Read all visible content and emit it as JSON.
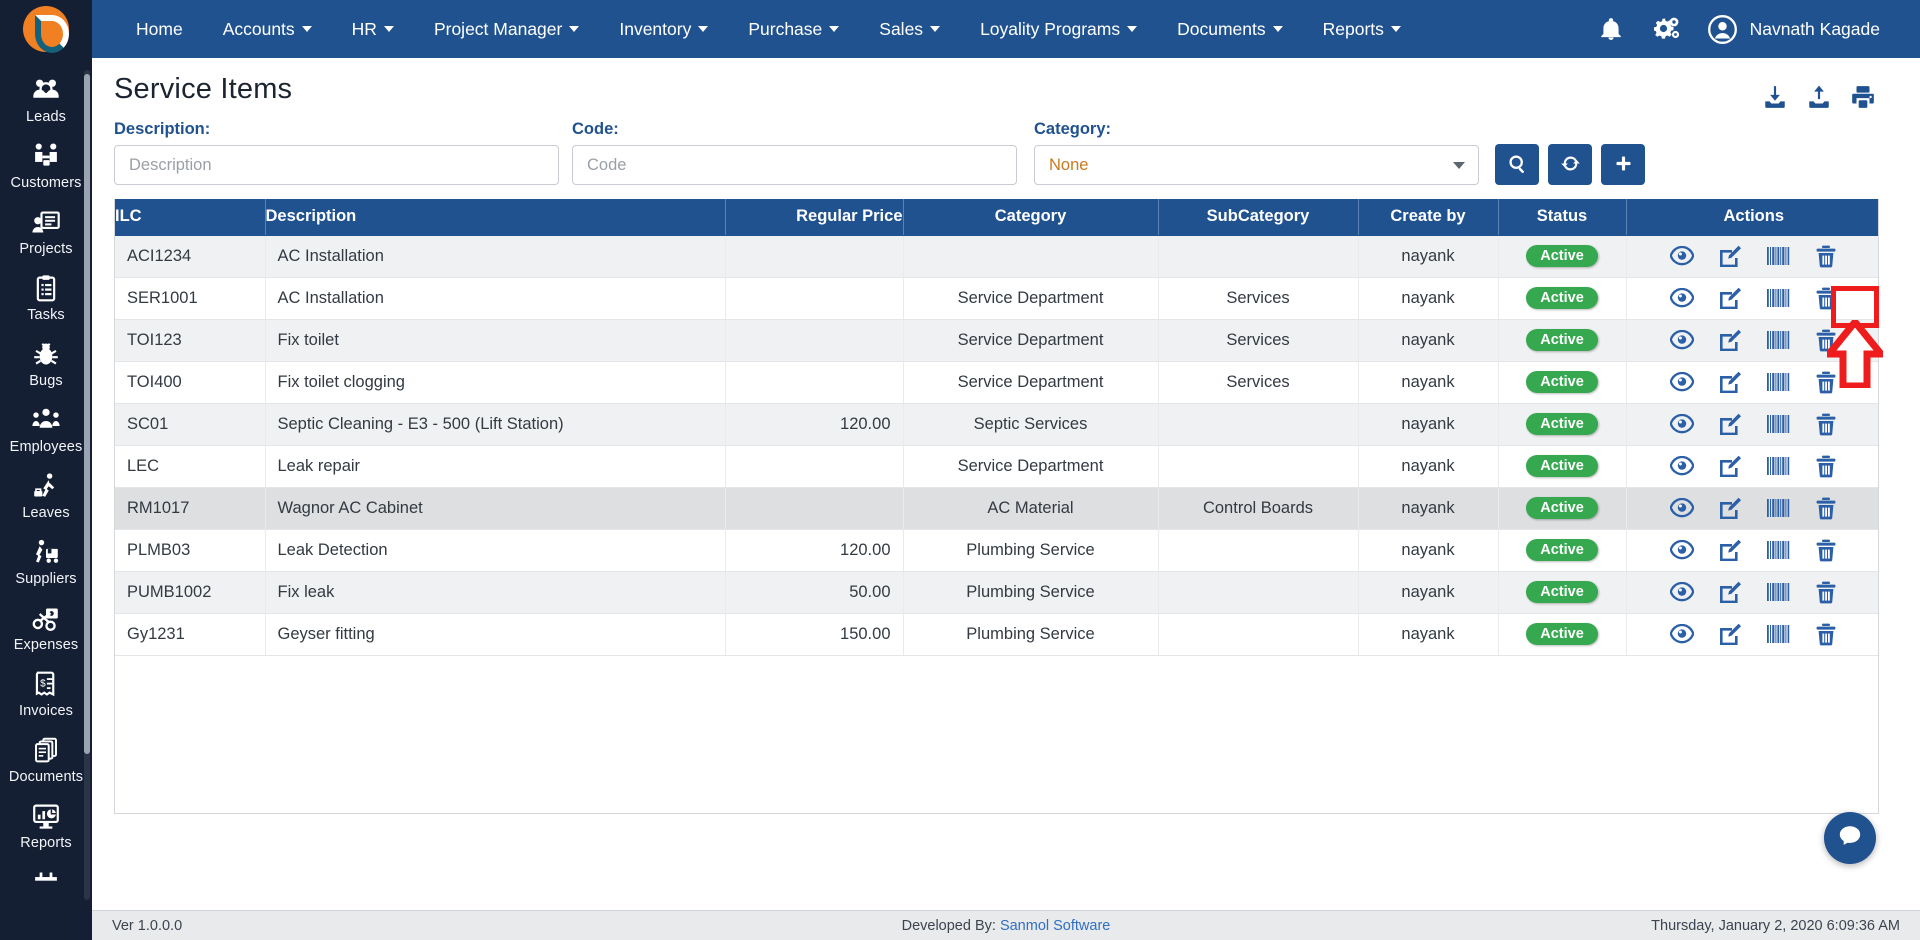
{
  "brand": {
    "logo_alt": "e-logo"
  },
  "topnav": {
    "items": [
      {
        "label": "Home",
        "caret": false
      },
      {
        "label": "Accounts",
        "caret": true
      },
      {
        "label": "HR",
        "caret": true
      },
      {
        "label": "Project Manager",
        "caret": true
      },
      {
        "label": "Inventory",
        "caret": true
      },
      {
        "label": "Purchase",
        "caret": true
      },
      {
        "label": "Sales",
        "caret": true
      },
      {
        "label": "Loyality Programs",
        "caret": true
      },
      {
        "label": "Documents",
        "caret": true
      },
      {
        "label": "Reports",
        "caret": true
      }
    ],
    "user_name": "Navnath Kagade"
  },
  "sidebar": {
    "items": [
      {
        "label": "Leads",
        "icon": "leads-icon"
      },
      {
        "label": "Customers",
        "icon": "customers-icon"
      },
      {
        "label": "Projects",
        "icon": "projects-icon"
      },
      {
        "label": "Tasks",
        "icon": "tasks-icon"
      },
      {
        "label": "Bugs",
        "icon": "bugs-icon"
      },
      {
        "label": "Employees",
        "icon": "employees-icon"
      },
      {
        "label": "Leaves",
        "icon": "leaves-icon"
      },
      {
        "label": "Suppliers",
        "icon": "suppliers-icon"
      },
      {
        "label": "Expenses",
        "icon": "expenses-icon"
      },
      {
        "label": "Invoices",
        "icon": "invoices-icon"
      },
      {
        "label": "Documents",
        "icon": "documents-icon"
      },
      {
        "label": "Reports",
        "icon": "reports-icon"
      }
    ]
  },
  "page": {
    "title": "Service Items",
    "tools": [
      {
        "name": "download-icon"
      },
      {
        "name": "upload-icon"
      },
      {
        "name": "print-icon"
      }
    ]
  },
  "filters": {
    "description_label": "Description:",
    "description_placeholder": "Description",
    "description_value": "",
    "code_label": "Code:",
    "code_placeholder": "Code",
    "code_value": "",
    "category_label": "Category:",
    "category_selected": "None",
    "buttons": [
      {
        "name": "search-button",
        "icon": "search-icon"
      },
      {
        "name": "refresh-button",
        "icon": "refresh-icon"
      },
      {
        "name": "add-button",
        "icon": "plus-icon"
      }
    ]
  },
  "table": {
    "columns": [
      "ILC",
      "Description",
      "Regular Price",
      "Category",
      "SubCategory",
      "Create by",
      "Status",
      "Actions"
    ],
    "rows": [
      {
        "ilc": "ACI1234",
        "description": "AC Installation",
        "price": "",
        "category": "",
        "subcategory": "",
        "created_by": "nayank",
        "status": "Active"
      },
      {
        "ilc": "SER1001",
        "description": "AC Installation",
        "price": "",
        "category": "Service Department",
        "subcategory": "Services",
        "created_by": "nayank",
        "status": "Active"
      },
      {
        "ilc": "TOI123",
        "description": "Fix toilet",
        "price": "",
        "category": "Service Department",
        "subcategory": "Services",
        "created_by": "nayank",
        "status": "Active"
      },
      {
        "ilc": "TOI400",
        "description": "Fix toilet clogging",
        "price": "",
        "category": "Service Department",
        "subcategory": "Services",
        "created_by": "nayank",
        "status": "Active"
      },
      {
        "ilc": "SC01",
        "description": "Septic Cleaning - E3 - 500 (Lift Station)",
        "price": "120.00",
        "category": "Septic Services",
        "subcategory": "",
        "created_by": "nayank",
        "status": "Active"
      },
      {
        "ilc": "LEC",
        "description": "Leak repair",
        "price": "",
        "category": "Service Department",
        "subcategory": "",
        "created_by": "nayank",
        "status": "Active"
      },
      {
        "ilc": "RM1017",
        "description": "Wagnor AC Cabinet",
        "price": "",
        "category": "AC Material",
        "subcategory": "Control Boards",
        "created_by": "nayank",
        "status": "Active"
      },
      {
        "ilc": "PLMB03",
        "description": "Leak Detection",
        "price": "120.00",
        "category": "Plumbing Service",
        "subcategory": "",
        "created_by": "nayank",
        "status": "Active"
      },
      {
        "ilc": "PUMB1002",
        "description": "Fix leak",
        "price": "50.00",
        "category": "Plumbing Service",
        "subcategory": "",
        "created_by": "nayank",
        "status": "Active"
      },
      {
        "ilc": "Gy1231",
        "description": "Geyser fitting",
        "price": "150.00",
        "category": "Plumbing Service",
        "subcategory": "",
        "created_by": "nayank",
        "status": "Active"
      }
    ],
    "row_actions": [
      {
        "name": "view-action-icon"
      },
      {
        "name": "edit-action-icon"
      },
      {
        "name": "barcode-action-icon"
      },
      {
        "name": "delete-action-icon"
      }
    ]
  },
  "annotation": {
    "target": "edit-action-icon-row-1",
    "color": "#ee1c1c"
  },
  "footer": {
    "version": "Ver 1.0.0.0",
    "developed_prefix": "Developed By:",
    "developed_by": "Sanmol Software",
    "datetime": "Thursday, January 2, 2020 6:09:36 AM"
  },
  "colors": {
    "primary": "#215290",
    "sidebar": "#151f33",
    "accent_orange": "#f08022",
    "status_green": "#36a84f",
    "annotation_red": "#ee1c1c"
  }
}
